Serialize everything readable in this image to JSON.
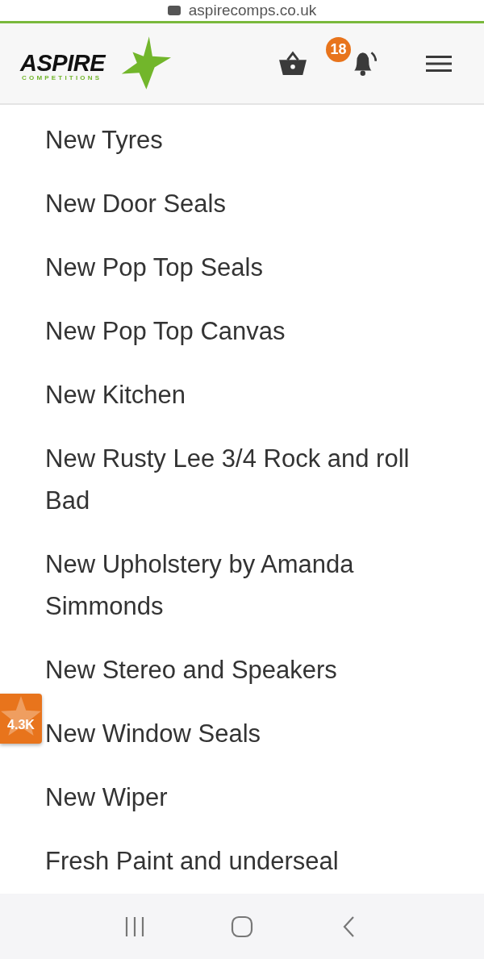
{
  "browser": {
    "url": "aspirecomps.co.uk"
  },
  "header": {
    "logo": {
      "name": "ASPIRE",
      "tagline": "COMPETITIONS"
    },
    "notifications": {
      "count": "18"
    }
  },
  "items": [
    {
      "label": "New Tyres"
    },
    {
      "label": "New Door Seals"
    },
    {
      "label": "New Pop Top Seals"
    },
    {
      "label": "New Pop Top Canvas"
    },
    {
      "label": "New Kitchen"
    },
    {
      "label": "New Rusty Lee 3/4 Rock and roll Bad"
    },
    {
      "label": "New Upholstery by Amanda Simmonds"
    },
    {
      "label": "New Stereo and Speakers"
    },
    {
      "label": "New Window Seals"
    },
    {
      "label": "New Wiper"
    },
    {
      "label": "Fresh Paint and underseal"
    }
  ],
  "review_badge": {
    "count": "4.3K"
  }
}
